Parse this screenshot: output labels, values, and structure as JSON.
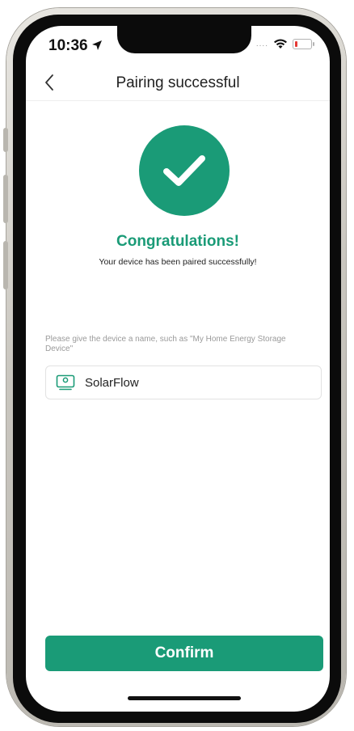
{
  "status_bar": {
    "time": "10:36",
    "signal_dots": "....",
    "battery_color": "#e53935"
  },
  "navbar": {
    "title": "Pairing successful",
    "back_icon": "chevron-left-icon"
  },
  "success": {
    "icon": "check-icon",
    "accent_color": "#1a9b77",
    "heading": "Congratulations!",
    "message": "Your device has been paired successfully!"
  },
  "device_name": {
    "hint": "Please give the device a name, such as \"My Home Energy Storage Device\"",
    "icon": "device-icon",
    "value": "SolarFlow"
  },
  "confirm": {
    "label": "Confirm"
  }
}
